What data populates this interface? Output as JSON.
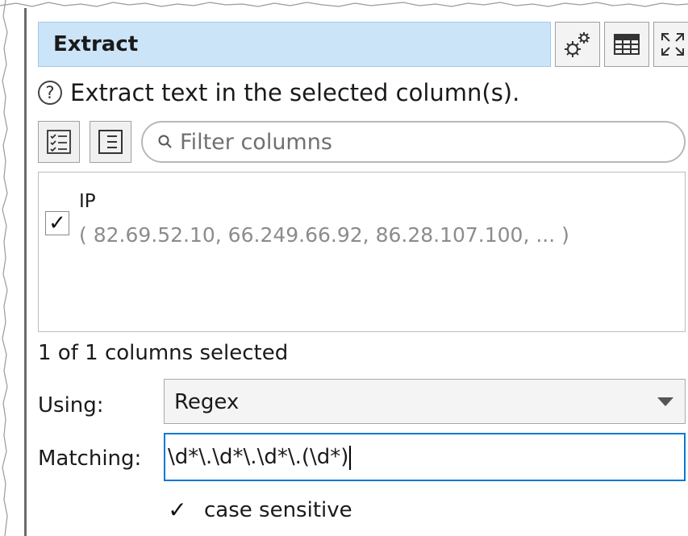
{
  "header": {
    "title": "Extract",
    "buttons": [
      {
        "name": "settings",
        "icon": "gear-icon"
      },
      {
        "name": "table",
        "icon": "table-icon"
      },
      {
        "name": "expand",
        "icon": "expand-icon"
      }
    ]
  },
  "help": {
    "icon": "question-icon",
    "text": "Extract text in the selected column(s)."
  },
  "filter": {
    "placeholder": "Filter columns",
    "select_all_icon": "checklist-icon",
    "select_none_icon": "list-icon"
  },
  "columns": [
    {
      "name": "IP",
      "checked": true,
      "values": "( 82.69.52.10, 66.249.66.92, 86.28.107.100, ... )"
    }
  ],
  "selection_status": "1 of 1 columns selected",
  "using": {
    "label": "Using:",
    "value": "Regex"
  },
  "matching": {
    "label": "Matching:",
    "value": "\\d*\\.\\d*\\.\\d*\\.(\\d*)"
  },
  "case_sensitive": {
    "label": "case sensitive",
    "checked": true
  },
  "colors": {
    "title_bg": "#cce4f7",
    "focus_border": "#0a78d4",
    "muted_text": "#8c8c8c"
  }
}
